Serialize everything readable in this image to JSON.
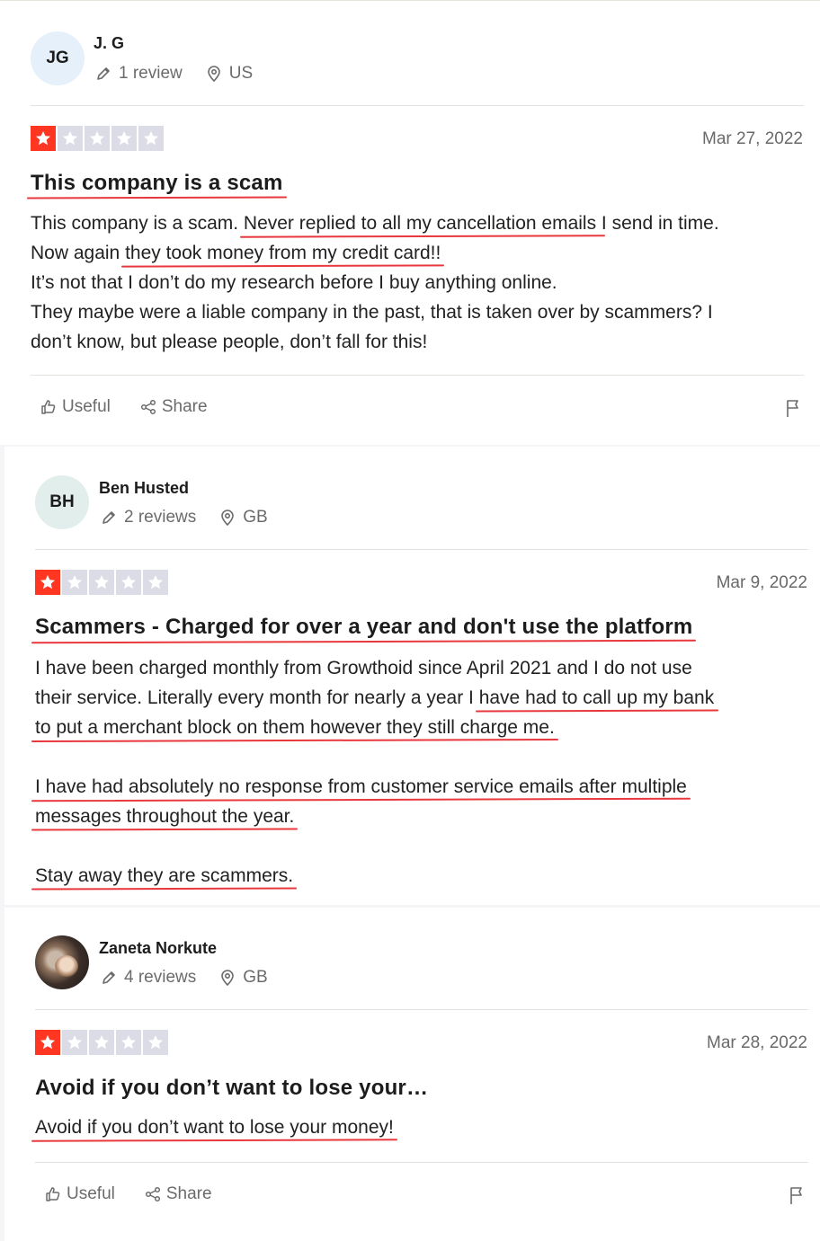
{
  "colors": {
    "star_red": "#ff3722",
    "star_gray": "#dcdce6",
    "underline": "#e8383d"
  },
  "reviews": [
    {
      "initials": "JG",
      "avatar_bg": "#e6f0fb",
      "name": "J. G",
      "reviews_count": "1 review",
      "country": "US",
      "rating": 1,
      "date": "Mar 27, 2022",
      "title": "This company is a scam",
      "body": [
        [
          "This company is a scam. ",
          "Never replied to all my cancellation emails ",
          "I send in time."
        ],
        [
          "Now again ",
          "they took money from my credit card!!",
          ""
        ],
        [
          "It’s not that I don’t do my research before I buy anything online.",
          "",
          ""
        ],
        [
          "They maybe were a liable company in the past, that is taken over by scammers? I",
          "",
          ""
        ],
        [
          "don’t know, but please people, don’t fall for this!",
          "",
          ""
        ]
      ],
      "useful_label": "Useful",
      "share_label": "Share"
    },
    {
      "initials": "BH",
      "avatar_bg": "#e1eeeb",
      "name": "Ben Husted",
      "reviews_count": "2 reviews",
      "country": "GB",
      "rating": 1,
      "date": "Mar 9, 2022",
      "title": "Scammers - Charged for over a year and don't use the platform",
      "body": [
        [
          "I have been charged monthly from Growthoid since April 2021 and I do not use",
          "",
          ""
        ],
        [
          "their service. Literally every month for nearly a year I ",
          "have had to call up my bank",
          ""
        ],
        [
          "",
          "to put a merchant block on them however they still charge me.",
          ""
        ],
        [
          "",
          "",
          ""
        ],
        [
          "",
          "I have had absolutely no response from customer service emails after multiple",
          ""
        ],
        [
          "",
          "messages throughout the year.",
          ""
        ],
        [
          "",
          "",
          ""
        ],
        [
          "",
          "Stay away they are scammers.",
          ""
        ]
      ]
    },
    {
      "initials": "",
      "name": "Zaneta Norkute",
      "reviews_count": "4 reviews",
      "country": "GB",
      "rating": 1,
      "date": "Mar 28, 2022",
      "title": "Avoid if you don’t want to lose your…",
      "body": [
        [
          "",
          "Avoid if you don’t want to lose your money!",
          ""
        ]
      ],
      "useful_label": "Useful",
      "share_label": "Share"
    }
  ]
}
